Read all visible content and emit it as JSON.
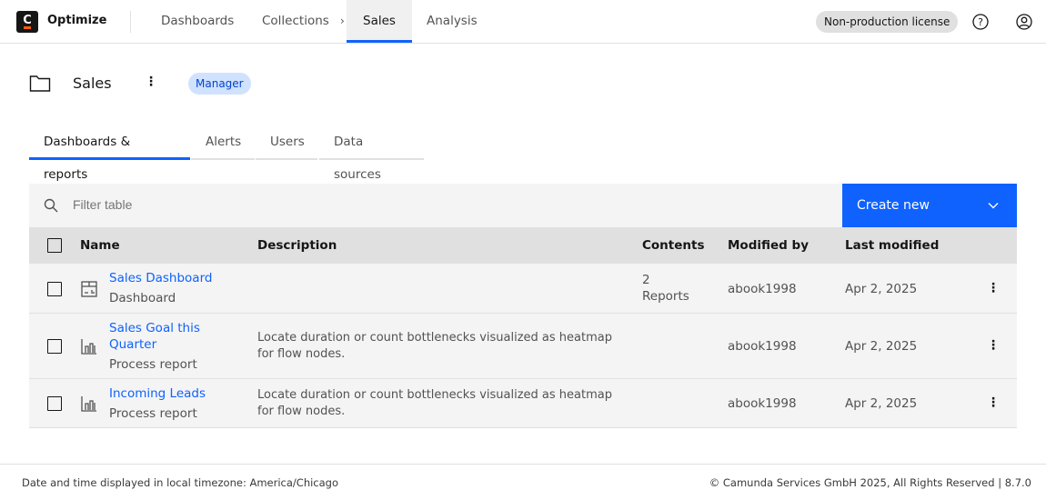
{
  "header": {
    "brand": "Optimize",
    "logo_letter": "C",
    "nav": [
      {
        "label": "Dashboards"
      },
      {
        "label": "Collections"
      },
      {
        "label": "Sales"
      },
      {
        "label": "Analysis"
      }
    ],
    "breadcrumb_sep": "›",
    "license": "Non-production license"
  },
  "collection": {
    "title": "Sales",
    "role": "Manager"
  },
  "tabs": [
    "Dashboards & reports",
    "Alerts",
    "Users",
    "Data sources"
  ],
  "toolbar": {
    "filter_placeholder": "Filter table",
    "create": "Create new"
  },
  "table": {
    "headers": [
      "Name",
      "Description",
      "Contents",
      "Modified by",
      "Last modified"
    ],
    "rows": [
      {
        "name": "Sales Dashboard",
        "type": "Dashboard",
        "description": "",
        "contents_count": "2",
        "contents_unit": "Reports",
        "modified_by": "abook1998",
        "last_modified": "Apr 2, 2025",
        "icon": "dashboard-icon"
      },
      {
        "name1": "Sales Goal this",
        "name2": "Quarter",
        "type": "Process report",
        "desc1": "Locate duration or count bottlenecks visualized as heatmap",
        "desc2": "for flow nodes.",
        "modified_by": "abook1998",
        "last_modified": "Apr 2, 2025",
        "icon": "report-icon"
      },
      {
        "name": "Incoming Leads",
        "type": "Process report",
        "desc1": "Locate duration or count bottlenecks visualized as heatmap",
        "desc2": "for flow nodes.",
        "modified_by": "abook1998",
        "last_modified": "Apr 2, 2025",
        "icon": "report-icon"
      }
    ]
  },
  "footer": {
    "timezone": "Date and time displayed in local timezone: America/Chicago",
    "copyright": "© Camunda Services GmbH 2025, All Rights Reserved | 8.7.0"
  }
}
